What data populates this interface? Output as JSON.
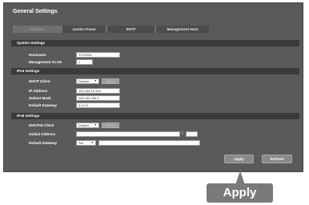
{
  "page": {
    "title": "General Settings"
  },
  "tabs": [
    {
      "label": "System",
      "active": true
    },
    {
      "label": "Jumbo Frame",
      "active": false
    },
    {
      "label": "SNTP",
      "active": false
    },
    {
      "label": "Management Host",
      "active": false
    }
  ],
  "system_settings": {
    "heading": "System Settings",
    "hostname_label": "Hostname",
    "hostname_value": "TI-PGS4/",
    "mgmt_vlan_label": "Management VLAN",
    "mgmt_vlan_value": "1"
  },
  "ipv4_settings": {
    "heading": "IPv4 Settings",
    "dhcp_label": "DHCP Client",
    "dhcp_value": "Disable",
    "renew_label": "Renew",
    "ip_label": "IP Address",
    "ip_value": "192.168.10.200",
    "mask_label": "Subnet Mask",
    "mask_value": "255.255.255.0",
    "gateway_label": "Default Gateway",
    "gateway_value": "0.0.0.0"
  },
  "ipv6_settings": {
    "heading": "IPv6 Settings",
    "dhcp_label": "DHCPv6 Client",
    "dhcp_value": "Disable",
    "renew_label": "Renew",
    "global_label": "Global Address",
    "global_value": "",
    "prefix_value": "",
    "prefix_separator": "/",
    "gateway_label": "Default Gateway",
    "gateway_select": "Set",
    "gateway_value": ""
  },
  "actions": {
    "apply_label": "Apply",
    "refresh_label": "Refresh"
  },
  "callout": {
    "label": "Apply"
  },
  "icons": {
    "dropdown": "caret-down-icon",
    "callout_arrow": "arrow-up-icon"
  },
  "colors": {
    "panel": "#5a5a5a",
    "section_bar": "#3a3a3a",
    "callout": "#7a7a7a"
  }
}
